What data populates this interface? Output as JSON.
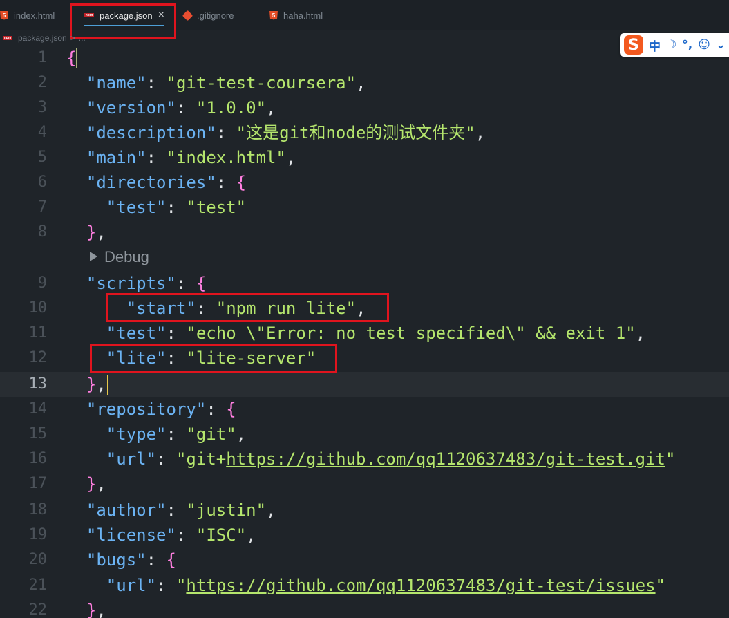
{
  "tabs": [
    {
      "label": "index.html",
      "icon": "html5-icon"
    },
    {
      "label": "package.json",
      "icon": "npm-icon",
      "active": true,
      "close": "×"
    },
    {
      "label": ".gitignore",
      "icon": "git-icon"
    },
    {
      "label": "haha.html",
      "icon": "html5-icon"
    }
  ],
  "breadcrumb": {
    "file": "package.json",
    "sep": ">",
    "rest": "..."
  },
  "ime": {
    "logo": "S",
    "mode": "中",
    "moon": "☽",
    "punct": "°,",
    "emoji": "☺",
    "more": "⌄"
  },
  "codelens": {
    "label": "Debug"
  },
  "editor": {
    "current_line": "13",
    "lines": [
      {
        "n": "1"
      },
      {
        "n": "2",
        "key": "name",
        "value": "git-test-coursera"
      },
      {
        "n": "3",
        "key": "version",
        "value": "1.0.0"
      },
      {
        "n": "4",
        "key": "description",
        "value": "这是git和node的测试文件夹"
      },
      {
        "n": "5",
        "key": "main",
        "value": "index.html"
      },
      {
        "n": "6",
        "key": "directories"
      },
      {
        "n": "7",
        "key": "test",
        "value": "test"
      },
      {
        "n": "8"
      },
      {
        "n": "9",
        "key": "scripts"
      },
      {
        "n": "10",
        "key": "start",
        "value": "npm run lite"
      },
      {
        "n": "11",
        "key": "test",
        "value": "echo \\\"Error: no test specified\\\" && exit 1"
      },
      {
        "n": "12",
        "key": "lite",
        "value": "lite-server"
      },
      {
        "n": "13"
      },
      {
        "n": "14",
        "key": "repository"
      },
      {
        "n": "15",
        "key": "type",
        "value": "git"
      },
      {
        "n": "16",
        "key": "url",
        "value_prefix": "git+",
        "value_link": "https://github.com/qq1120637483/git-test.git"
      },
      {
        "n": "17"
      },
      {
        "n": "18",
        "key": "author",
        "value": "justin"
      },
      {
        "n": "19",
        "key": "license",
        "value": "ISC"
      },
      {
        "n": "20",
        "key": "bugs"
      },
      {
        "n": "21",
        "key": "url",
        "value_link": "https://github.com/qq1120637483/git-test/issues"
      },
      {
        "n": "22"
      }
    ]
  },
  "colors": {
    "key": "#6bb3f3",
    "string": "#b5e66d",
    "bracket": "#ff7fe0",
    "annotation": "#e0141e",
    "cursor": "#e6c84a"
  }
}
